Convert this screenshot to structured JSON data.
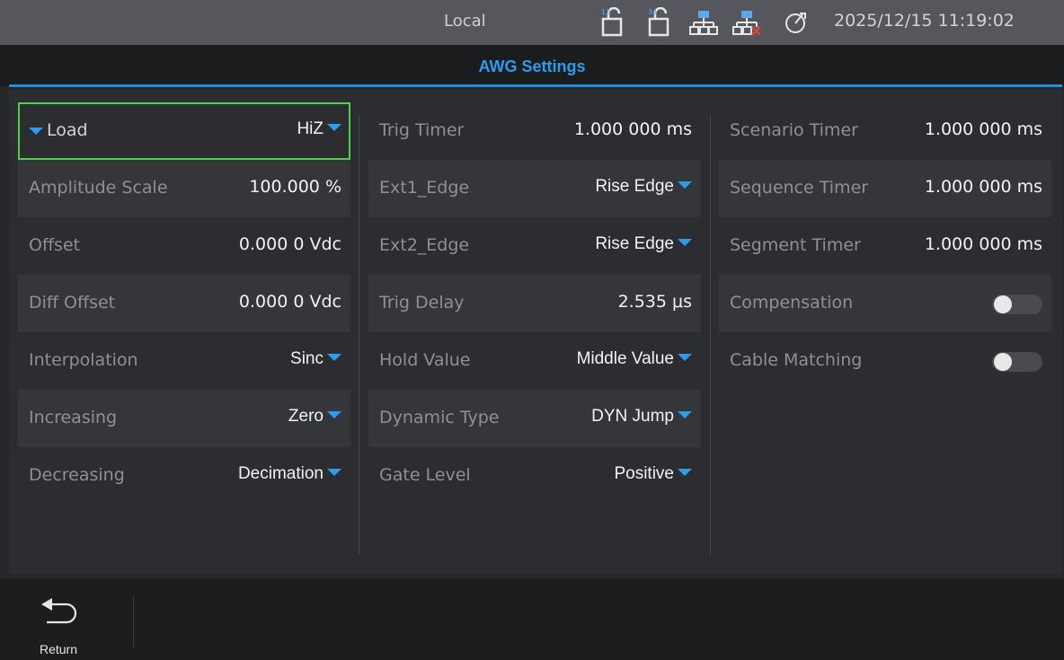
{
  "status": {
    "mode": "Local",
    "datetime": "2025/12/15 11:19:02",
    "icons": [
      "channel-12-icon",
      "channel-34-icon",
      "network-1-icon",
      "network-2-disconnected-icon",
      "timer-icon"
    ]
  },
  "title": "AWG Settings",
  "columns": {
    "left": [
      {
        "label": "Load",
        "value": "HiZ",
        "dropdown": true,
        "selected": true
      },
      {
        "label": "Amplitude Scale",
        "value": "100.000 %"
      },
      {
        "label": "Offset",
        "value": "0.000 0 Vdc"
      },
      {
        "label": "Diff Offset",
        "value": "0.000 0 Vdc"
      },
      {
        "label": "Interpolation",
        "value": "Sinc",
        "dropdown": true
      },
      {
        "label": "Increasing",
        "value": "Zero",
        "dropdown": true
      },
      {
        "label": "Decreasing",
        "value": "Decimation",
        "dropdown": true
      }
    ],
    "middle": [
      {
        "label": "Trig Timer",
        "value": "1.000 000 ms"
      },
      {
        "label": "Ext1_Edge",
        "value": "Rise Edge",
        "dropdown": true
      },
      {
        "label": "Ext2_Edge",
        "value": "Rise Edge",
        "dropdown": true
      },
      {
        "label": "Trig Delay",
        "value": "2.535 μs"
      },
      {
        "label": "Hold Value",
        "value": "Middle Value",
        "dropdown": true
      },
      {
        "label": "Dynamic Type",
        "value": "DYN Jump",
        "dropdown": true
      },
      {
        "label": "Gate Level",
        "value": "Positive",
        "dropdown": true
      }
    ],
    "right": [
      {
        "label": "Scenario Timer",
        "value": "1.000 000 ms"
      },
      {
        "label": "Sequence Timer",
        "value": "1.000 000 ms"
      },
      {
        "label": "Segment Timer",
        "value": "1.000 000 ms"
      },
      {
        "label": "Compensation",
        "toggle": "off"
      },
      {
        "label": "Cable Matching",
        "toggle": "off"
      }
    ]
  },
  "footer": {
    "return_label": "Return"
  },
  "colors": {
    "accent": "#2a9df0",
    "selection": "#4fd048"
  }
}
